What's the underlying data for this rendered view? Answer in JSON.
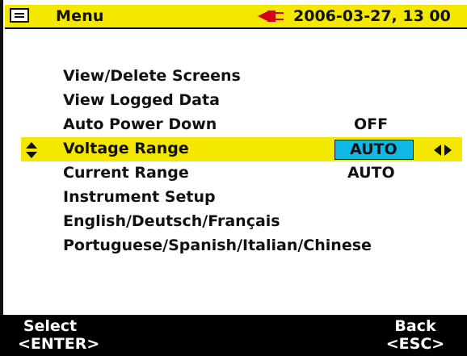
{
  "header": {
    "title": "Menu",
    "datetime": "2006-03-27, 13 00"
  },
  "menu": {
    "items": [
      {
        "label": "View/Delete Screens",
        "value": ""
      },
      {
        "label": "View Logged Data",
        "value": ""
      },
      {
        "label": "Auto Power Down",
        "value": "OFF"
      },
      {
        "label": "Voltage Range",
        "value": "AUTO",
        "selected": true
      },
      {
        "label": "Current Range",
        "value": "AUTO"
      },
      {
        "label": "Instrument Setup",
        "value": ""
      },
      {
        "label": "English/Deutsch/Français",
        "value": ""
      },
      {
        "label": "Portuguese/Spanish/Italian/Chinese",
        "value": ""
      }
    ]
  },
  "softkeys": {
    "left_top": "Select",
    "left_bottom": "<ENTER>",
    "right_top": "Back",
    "right_bottom": "<ESC>"
  },
  "colors": {
    "highlight": "#f5e800",
    "value_selected": "#10b8e6",
    "bar": "#000000"
  }
}
